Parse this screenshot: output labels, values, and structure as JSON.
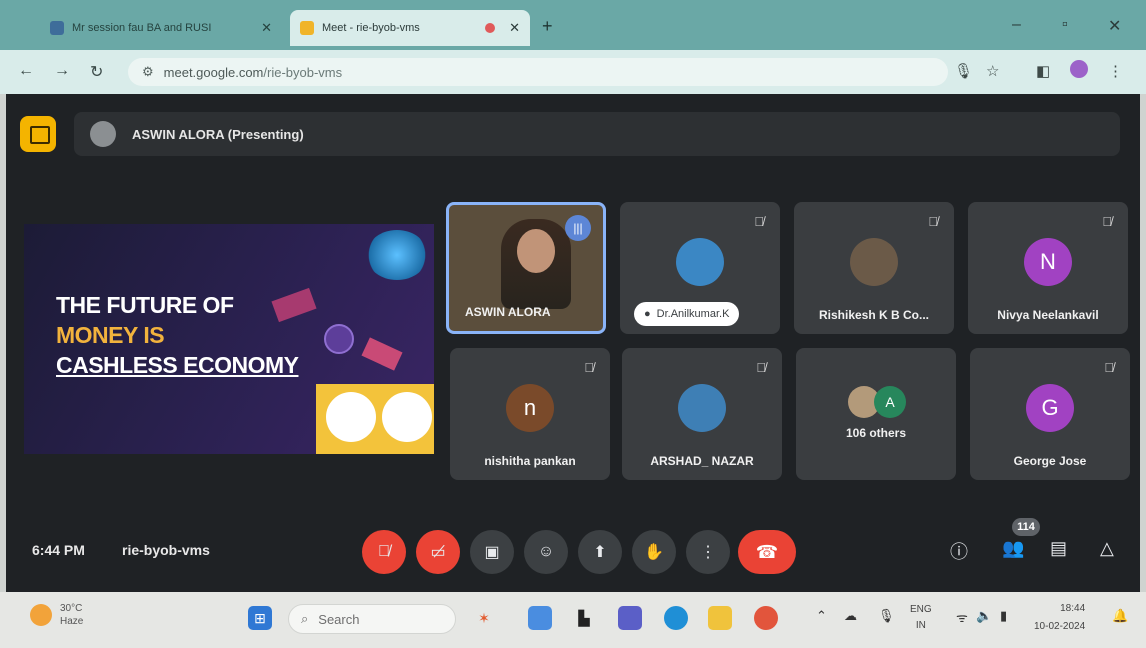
{
  "browser": {
    "tabs": [
      {
        "title": "Mr session fau BA and RUSI",
        "active": false
      },
      {
        "title": "Meet - rie-byob-vms",
        "active": true
      }
    ],
    "new_tab": "+",
    "url_host": "meet.google.com",
    "url_path": "/rie-byob-vms",
    "window_controls": {
      "minimize": "–",
      "maximize": "▫",
      "close": "✕"
    }
  },
  "meet": {
    "presenting_text": "ASWIN ALORA (Presenting)",
    "slide": {
      "line1": "THE FUTURE OF",
      "line2": "MONEY IS",
      "line3": "CASHLESS ECONOMY"
    },
    "tiles": [
      {
        "name": "ASWIN ALORA",
        "kind": "video",
        "speaking": true
      },
      {
        "name": "Dr.Anilkumar.K",
        "kind": "photo",
        "muted": true
      },
      {
        "name": "Rishikesh K B Co...",
        "kind": "photo",
        "muted": true
      },
      {
        "name": "Nivya Neelankavil",
        "kind": "initial",
        "initial": "N",
        "color": "#a142c2",
        "muted": true
      },
      {
        "name": "nishitha pankan",
        "kind": "initial",
        "initial": "n",
        "color": "#7a4a2a",
        "muted": true
      },
      {
        "name": "ARSHAD_ NAZAR",
        "kind": "photo",
        "muted": true
      },
      {
        "name": "106 others",
        "kind": "others",
        "initial": "A"
      },
      {
        "name": "George Jose",
        "kind": "initial",
        "initial": "G",
        "color": "#a142c2",
        "muted": true
      }
    ],
    "time": "6:44 PM",
    "meeting_code": "rie-byob-vms",
    "participant_count": "114",
    "accent_red": "#ea4335"
  },
  "taskbar": {
    "weather_temp": "30°C",
    "weather_desc": "Haze",
    "search_placeholder": "Search",
    "lang_top": "ENG",
    "lang_bottom": "IN",
    "clock_time": "18:44",
    "clock_date": "10-02-2024"
  }
}
